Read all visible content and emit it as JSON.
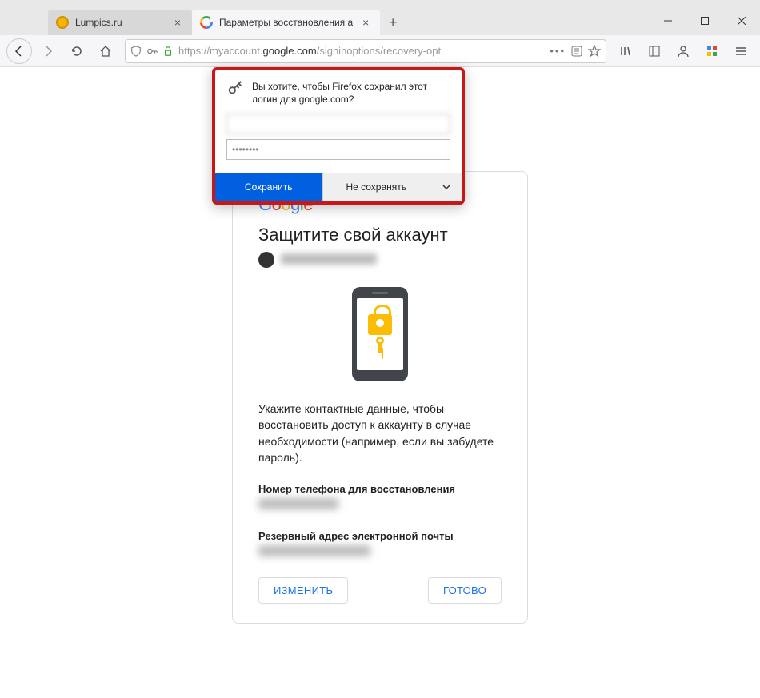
{
  "tabs": {
    "inactive": {
      "label": "Lumpics.ru"
    },
    "active": {
      "label": "Параметры восстановления а"
    }
  },
  "url": {
    "prefix": "https://myaccount.",
    "domain": "google.com",
    "path": "/signinoptions/recovery-opt"
  },
  "prompt": {
    "text": "Вы хотите, чтобы Firefox сохранил этот логин для google.com?",
    "username": "",
    "password": "••••••••",
    "save": "Сохранить",
    "dont": "Не сохранять"
  },
  "page": {
    "title": "Защитите свой аккаунт",
    "email": "",
    "desc": "Укажите контактные данные, чтобы восстановить доступ к аккаунту в случае необходимости (например, если вы забудете пароль).",
    "phone_label": "Номер телефона для восстановления",
    "phone_value": "",
    "email_label": "Резервный адрес электронной почты",
    "email_value": "",
    "change": "ИЗМЕНИТЬ",
    "done": "ГОТОВО"
  },
  "google_logo": {
    "g1": "G",
    "o1": "o",
    "o2": "o",
    "g2": "g",
    "l": "l",
    "e": "e"
  }
}
